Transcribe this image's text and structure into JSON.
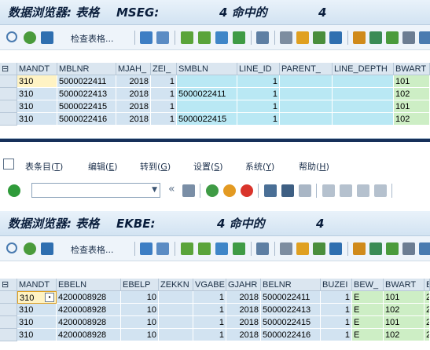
{
  "top": {
    "title": {
      "prefix": "数据浏览器: 表格",
      "table": "MSEG:",
      "hits_label": "4 命中的",
      "hits": "4"
    },
    "check_table_label": "检查表格...",
    "columns": [
      "MANDT",
      "MBLNR",
      "MJAH_",
      "ZEI_",
      "SMBLN",
      "LINE_ID",
      "PARENT_",
      "LINE_DEPTH",
      "BWART"
    ],
    "rows": [
      [
        "310",
        "5000022411",
        "2018",
        "1",
        "",
        "1",
        "",
        "",
        "101"
      ],
      [
        "310",
        "5000022413",
        "2018",
        "1",
        "5000022411",
        "1",
        "",
        "",
        "102"
      ],
      [
        "310",
        "5000022415",
        "2018",
        "1",
        "",
        "1",
        "",
        "",
        "101"
      ],
      [
        "310",
        "5000022416",
        "2018",
        "1",
        "5000022415",
        "1",
        "",
        "",
        "102"
      ]
    ]
  },
  "menu": {
    "items": [
      {
        "label": "表条目(",
        "key": "T",
        "end": ")"
      },
      {
        "label": "编辑(",
        "key": "E",
        "end": ")"
      },
      {
        "label": "转到(",
        "key": "G",
        "end": ")"
      },
      {
        "label": "设置(",
        "key": "S",
        "end": ")"
      },
      {
        "label": "系统(",
        "key": "Y",
        "end": ")"
      },
      {
        "label": "帮助(",
        "key": "H",
        "end": ")"
      }
    ]
  },
  "command_field": {
    "value": ""
  },
  "bottom": {
    "title": {
      "prefix": "数据浏览器: 表格",
      "table": "EKBE:",
      "hits_label": "4 命中的",
      "hits": "4"
    },
    "check_table_label": "检查表格...",
    "columns": [
      "MANDT",
      "EBELN",
      "EBELP",
      "ZEKKN",
      "VGABE",
      "GJAHR",
      "BELNR",
      "BUZEI",
      "BEW_",
      "BWART",
      "B"
    ],
    "rows": [
      [
        "310",
        "4200008928",
        "10",
        "",
        "1",
        "2018",
        "5000022411",
        "1",
        "E",
        "101",
        "2"
      ],
      [
        "310",
        "4200008928",
        "10",
        "",
        "1",
        "2018",
        "5000022413",
        "1",
        "E",
        "102",
        "2"
      ],
      [
        "310",
        "4200008928",
        "10",
        "",
        "1",
        "2018",
        "5000022415",
        "1",
        "E",
        "101",
        "2"
      ],
      [
        "310",
        "4200008928",
        "10",
        "",
        "1",
        "2018",
        "5000022416",
        "1",
        "E",
        "102",
        "2"
      ]
    ]
  },
  "colors": {
    "accent_blue": "#0a1e3c",
    "key_cell": "#d2e3f1",
    "data_cell": "#b9e8f4",
    "green_cell": "#cdeec5",
    "focus_cell": "#fff3c4"
  }
}
